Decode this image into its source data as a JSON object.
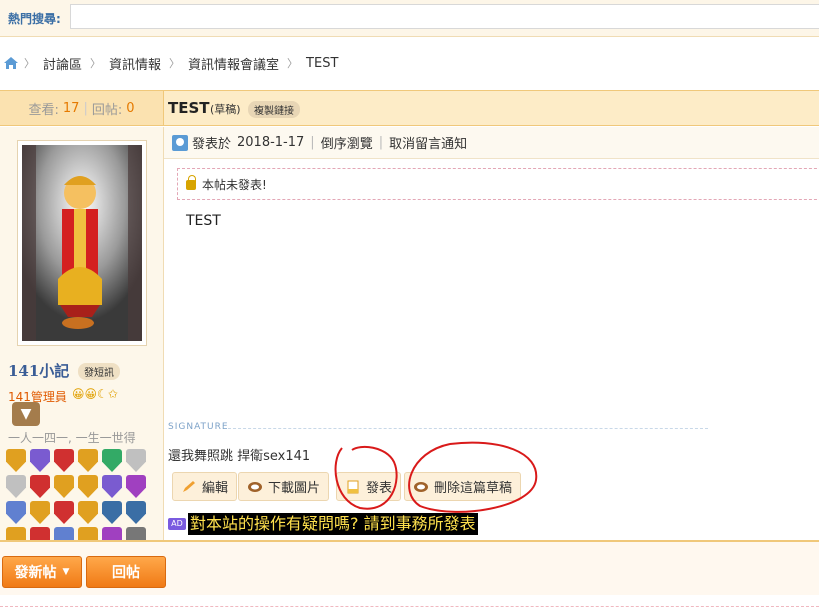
{
  "search": {
    "label": "熱門搜尋:",
    "value": ""
  },
  "breadcrumb": [
    "討論區",
    "資訊情報",
    "資訊情報會議室",
    "TEST"
  ],
  "header": {
    "views_label": "查看:",
    "views_value": "17",
    "replies_label": "回帖:",
    "replies_value": "0",
    "title": "TEST",
    "draft_tag": "(草稿)",
    "copy_link": "複製鏈接"
  },
  "author": {
    "name": "141小記",
    "pm_button": "發短訊",
    "group": "141管理員",
    "group_icons": "😀😀☾✩",
    "expand": "▼",
    "motto": "一人一四一, 一生一世得",
    "medals": [
      "#e0a020",
      "#7a5bd0",
      "#d03030",
      "#e0a020",
      "#3a6",
      "#c0c0c0",
      "#c0c0c0",
      "#d03030",
      "#e0a020",
      "#e0a020",
      "#7a5bd0",
      "#a040c0",
      "#6080d0",
      "#e0a020",
      "#d03030",
      "#e0a020",
      "#3a6ea5",
      "#3a6ea5",
      "#e0a020",
      "#d03030",
      "#6080d0",
      "#e0a020",
      "#a040c0",
      "#777"
    ]
  },
  "post_meta": {
    "posted_prefix": "發表於",
    "date": "2018-1-17",
    "reverse_view": "倒序瀏覽",
    "cancel_notify": "取消留言通知"
  },
  "locked_note": "本帖未發表!",
  "post_body": "TEST",
  "signature": {
    "label": "SIGNATURE",
    "text": "還我舞照跳   捍衛sex141"
  },
  "actions": {
    "edit": "編輯",
    "download": "下載圖片",
    "publish": "發表",
    "delete_draft": "刪除這篇草稿"
  },
  "ad": {
    "badge": "AD",
    "text": "對本站的操作有疑問嗎? 請到事務所發表"
  },
  "bottom": {
    "new_thread": "發新帖",
    "reply": "回帖"
  },
  "colors": {
    "accent": "#f07a15",
    "annotation": "#d91a1a"
  }
}
